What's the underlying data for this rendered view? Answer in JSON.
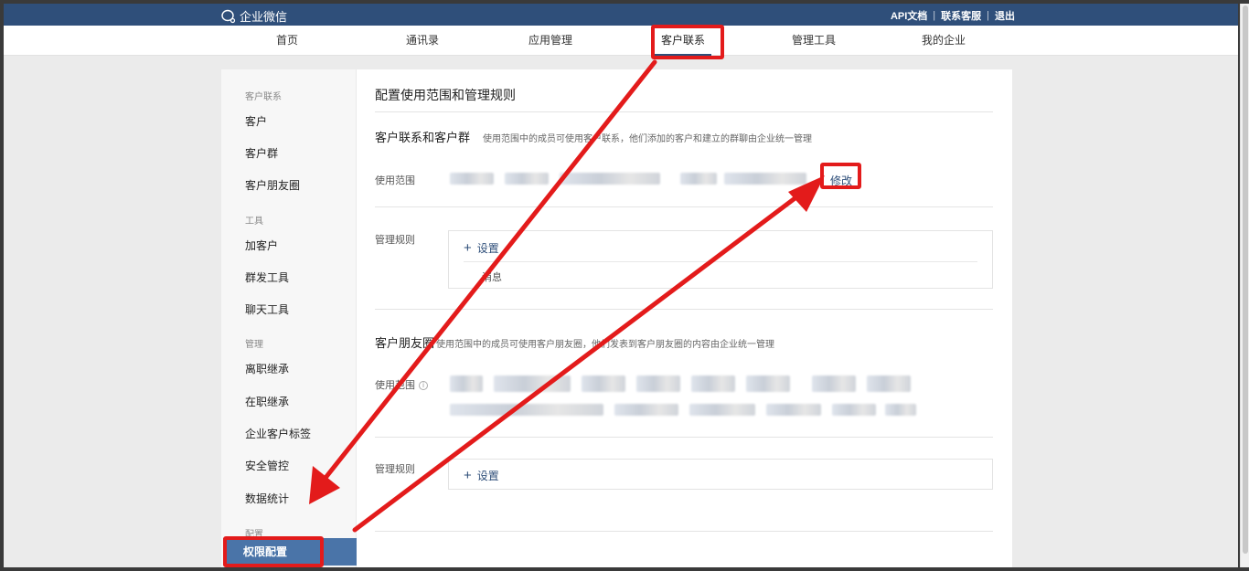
{
  "header": {
    "logo_text": "企业微信",
    "links": [
      "API文档",
      "联系客服",
      "退出"
    ]
  },
  "nav": {
    "items": [
      "首页",
      "通讯录",
      "应用管理",
      "客户联系",
      "管理工具",
      "我的企业"
    ],
    "active": "客户联系"
  },
  "sidebar": {
    "groups": [
      {
        "title": "客户联系",
        "items": [
          "客户",
          "客户群",
          "客户朋友圈"
        ]
      },
      {
        "title": "工具",
        "items": [
          "加客户",
          "群发工具",
          "聊天工具"
        ]
      },
      {
        "title": "管理",
        "items": [
          "离职继承",
          "在职继承",
          "企业客户标签",
          "安全管控",
          "数据统计"
        ]
      },
      {
        "title": "配置",
        "items": [
          "权限配置"
        ]
      }
    ],
    "active_item": "权限配置"
  },
  "main": {
    "title": "配置使用范围和管理规则",
    "section1": {
      "title": "客户联系和客户群",
      "desc": "使用范围中的成员可使用客户联系，他们添加的客户和建立的群聊由企业统一管理",
      "scope_label": "使用范围",
      "edit_label": "修改",
      "rules_label": "管理规则",
      "add_label": "设置",
      "sub_text": "消息"
    },
    "section2": {
      "title": "客户朋友圈",
      "desc": "使用范围中的成员可使用客户朋友圈，他们发表到客户朋友圈的内容由企业统一管理",
      "scope_label": "使用范围",
      "rules_label": "管理规则",
      "add_label": "设置"
    }
  },
  "annotation": {
    "color": "#e31b1b"
  }
}
